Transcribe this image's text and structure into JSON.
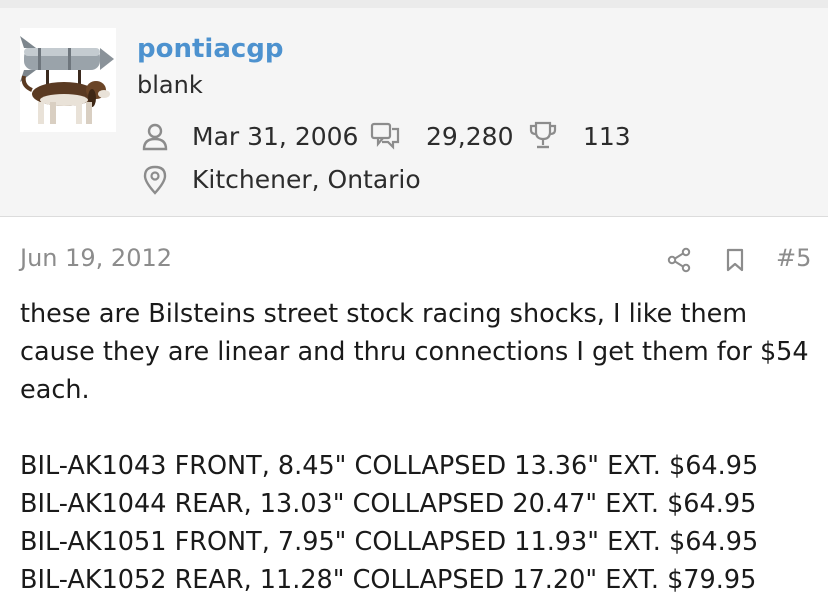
{
  "user": {
    "username": "pontiacgp",
    "title": "blank",
    "joined": "Mar 31, 2006",
    "messages": "29,280",
    "reaction_score": "113",
    "location": "Kitchener, Ontario"
  },
  "post": {
    "date": "Jun 19, 2012",
    "number": "#5",
    "body_paragraph": "these are Bilsteins street stock racing shocks, I like them cause they are linear and thru connections I get them for $54 each.",
    "parts": [
      "BIL-AK1043 FRONT, 8.45\" COLLAPSED 13.36\" EXT. $64.95",
      "BIL-AK1044 REAR, 13.03\" COLLAPSED 20.47\" EXT. $64.95",
      "BIL-AK1051 FRONT, 7.95\" COLLAPSED 11.93\" EXT. $64.95",
      "BIL-AK1052 REAR, 11.28\" COLLAPSED 17.20\" EXT. $79.95"
    ]
  },
  "icons": {
    "joined": "user-icon",
    "messages": "messages-icon",
    "reactions": "trophy-icon",
    "location": "location-pin-icon",
    "share": "share-icon",
    "bookmark": "bookmark-icon"
  },
  "colors": {
    "username": "#4d92cf",
    "header_bg": "#f5f5f5",
    "muted_text": "#8c8c8c",
    "body_text": "#1a1a1a"
  }
}
